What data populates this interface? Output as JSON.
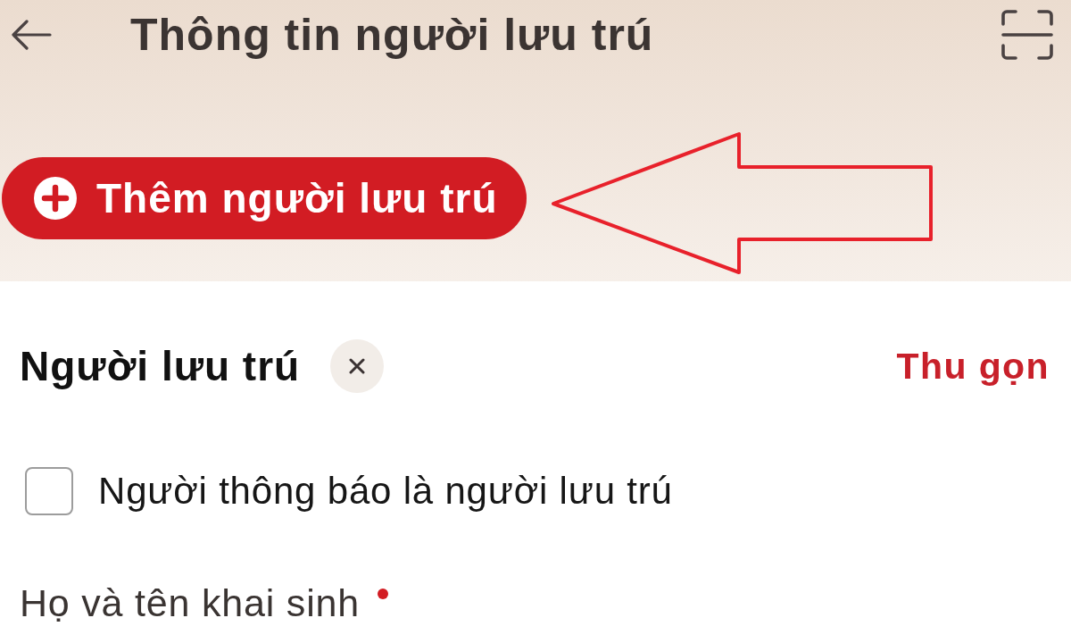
{
  "header": {
    "title": "Thông tin người lưu trú"
  },
  "add_button": {
    "label": "Thêm người lưu trú"
  },
  "section": {
    "title": "Người lưu trú",
    "collapse_link": "Thu gọn"
  },
  "checkbox": {
    "label": "Người thông báo là người lưu trú",
    "checked": false
  },
  "fields": [
    {
      "label": "Họ và tên khai sinh",
      "required": true
    }
  ]
}
